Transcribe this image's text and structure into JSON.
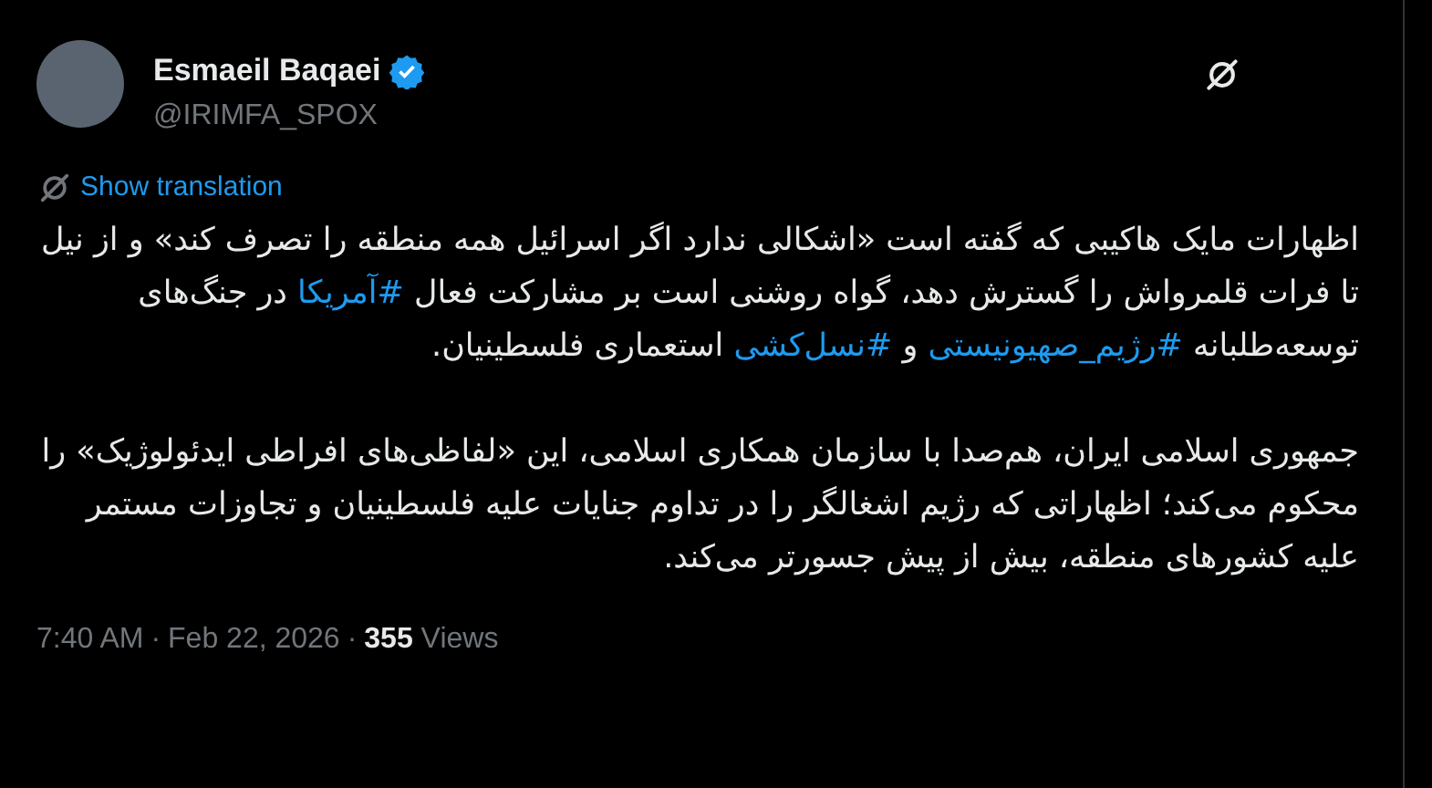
{
  "author": {
    "name": "Esmaeil Baqaei",
    "verified": true,
    "handle": "@IRIMFA_SPOX"
  },
  "translate": {
    "label": "Show translation"
  },
  "paragraphs": [
    [
      {
        "kind": "text",
        "text": "اظهارات مایک هاکیبی که گفته است «اشکالی ندارد اگر اسرائیل همه منطقه را تصرف کند» و از نیل تا فرات قلمرواش را گسترش دهد، گواه روشنی است بر مشارکت فعال "
      },
      {
        "kind": "hashtag",
        "text": "#آمریکا"
      },
      {
        "kind": "text",
        "text": " در جنگ‌های  توسعه‌طلبانه "
      },
      {
        "kind": "hashtag",
        "text": "#رژیم_صهیونیستی"
      },
      {
        "kind": "text",
        "text": "  و "
      },
      {
        "kind": "hashtag",
        "text": "#نسل‌کشی"
      },
      {
        "kind": "text",
        "text": " استعماری فلسطینیان."
      }
    ],
    [
      {
        "kind": "text",
        "text": "جمهوری اسلامی ایران، هم‌صدا با سازمان همکاری اسلامی، این «لفاظی‌های افراطی ایدئولوژیک» را محکوم می‌کند؛ اظهاراتی که رژیم اشغالگر را در تداوم جنایات علیه فلسطینیان و تجاوزات مستمر علیه کشورهای منطقه، بیش از پیش جسورتر می‌کند."
      }
    ]
  ],
  "meta": {
    "time": "7:40 AM",
    "separator_1": "·",
    "date": "Feb 22, 2026",
    "separator_2": "·",
    "views": "**355** Views"
  }
}
